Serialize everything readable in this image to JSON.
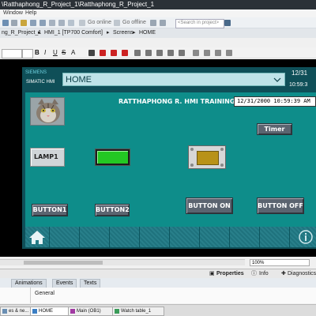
{
  "window": {
    "title": "\\Ratthaphong_R_Project_1\\Ratthaphong_R_Project_1"
  },
  "menu": {
    "items": [
      "Window",
      "Help"
    ]
  },
  "toolbar": {
    "go_online": "Go online",
    "go_offline": "Go offline",
    "search_placeholder": "<Search in project>"
  },
  "breadcrumb": {
    "parts": [
      "ng_R_Project_1",
      "HMI_1 [TP700 Comfort]",
      "Screens",
      "HOME"
    ],
    "separator": "▸"
  },
  "format_toolbar": {
    "buttons": [
      "B",
      "I",
      "U",
      "S",
      "A"
    ]
  },
  "hmi": {
    "brand": "SIEMENS",
    "model": "SIMATIC HMI",
    "screen_name": "HOME",
    "header_date": "12/31",
    "header_time": "10:59:3",
    "title": "RATTHAPHONG R. HMI TRAINING",
    "datetime_value": "12/31/2000 10:59:39 AM",
    "timer_label": "Timer",
    "lamp_label": "LAMP1",
    "button1_label": "BUTTON1",
    "button2_label": "BUTTON2",
    "button_on_label": "BUTTON ON",
    "button_off_label": "BUTTON OFF",
    "indicator_color": "#23c823",
    "teal_color": "#0e8d8a"
  },
  "zoom": {
    "value": "100%"
  },
  "properties": {
    "tabs": [
      "Properties",
      "Info",
      "Diagnostics"
    ],
    "sub_tabs": [
      "Animations",
      "Events",
      "Texts"
    ],
    "section": "General"
  },
  "taskbar": {
    "items": [
      "es & ne...",
      "HOME",
      "Main (OB1)",
      "Watch table_1"
    ]
  }
}
